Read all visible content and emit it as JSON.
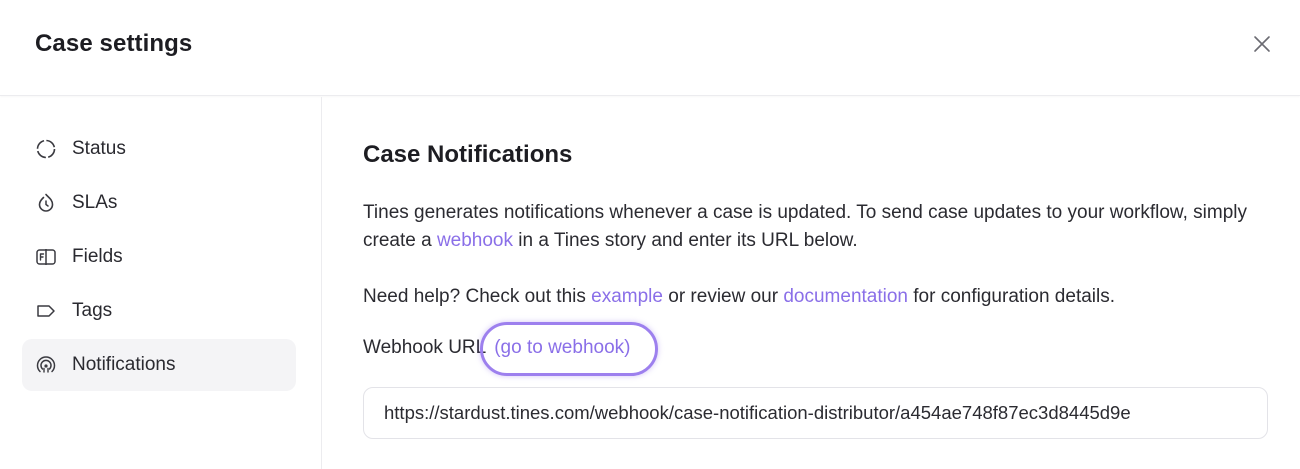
{
  "dialog": {
    "title": "Case settings",
    "close_icon": "close-icon"
  },
  "sidebar": {
    "items": [
      {
        "label": "Status",
        "icon": "status-icon",
        "active": false
      },
      {
        "label": "SLAs",
        "icon": "sla-icon",
        "active": false
      },
      {
        "label": "Fields",
        "icon": "fields-icon",
        "active": false
      },
      {
        "label": "Tags",
        "icon": "tag-icon",
        "active": false
      },
      {
        "label": "Notifications",
        "icon": "notifications-icon",
        "active": true
      }
    ]
  },
  "main": {
    "heading": "Case Notifications",
    "intro": {
      "before": "Tines generates notifications whenever a case is updated. To send case updates to your workflow, simply create a ",
      "link": "webhook",
      "after": " in a Tines story and enter its URL below."
    },
    "help": {
      "before": "Need help? Check out this ",
      "link1": "example",
      "middle": " or review our ",
      "link2": "documentation",
      "after": " for configuration details."
    },
    "webhook": {
      "label": "Webhook URL",
      "go_link": "(go to webhook)",
      "value": "https://stardust.tines.com/webhook/case-notification-distributor/a454ae748f87ec3d8445d9e"
    }
  },
  "colors": {
    "accent": "#8a6fe8",
    "highlight_ring": "#9d80ee",
    "active_bg": "#f4f4f6"
  }
}
